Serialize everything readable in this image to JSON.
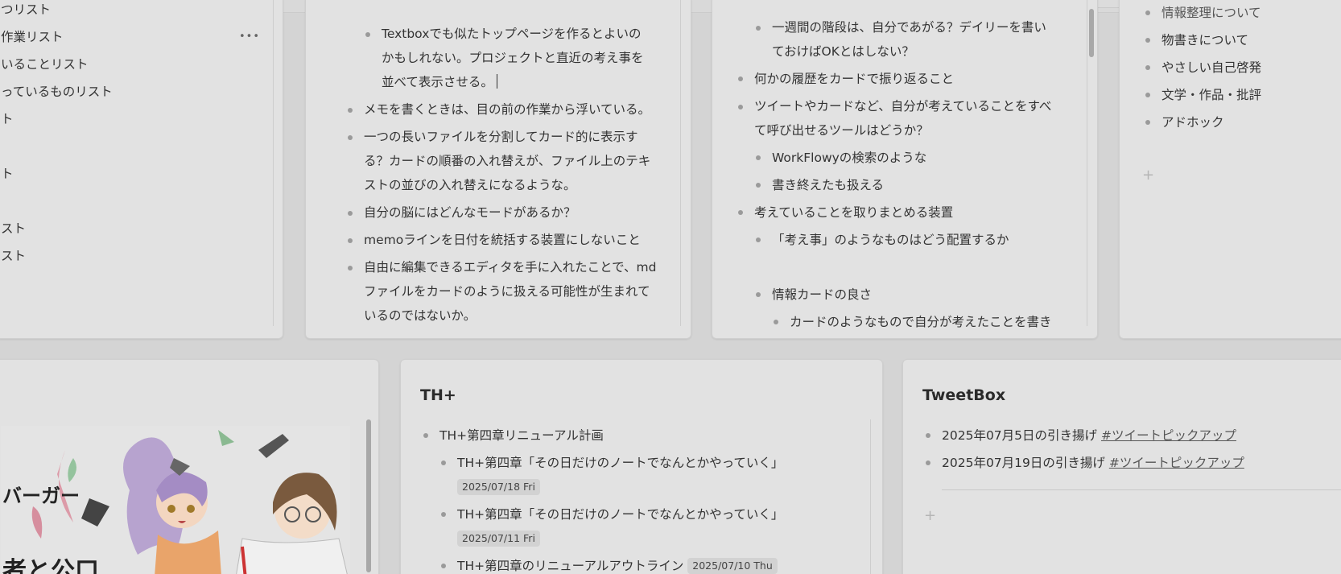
{
  "card1": {
    "items": [
      "つリスト",
      "作業リスト",
      "いることリスト",
      "っているものリスト",
      "ト",
      "",
      "ト",
      "",
      "スト",
      "スト"
    ],
    "more_label": "•••"
  },
  "card2": {
    "items": [
      {
        "text": "Textboxでも似たトップページを作るとよいのかもしれない。プロジェクトと直近の考え事を並べて表示させる。",
        "level": 2
      },
      {
        "text": "メモを書くときは、目の前の作業から浮いている。",
        "level": 1
      },
      {
        "text": "一つの長いファイルを分割してカード的に表示する？カードの順番の入れ替えが、ファイル上のテキストの並びの入れ替えになるような。",
        "level": 1
      },
      {
        "text": "自分の脳にはどんなモードがあるか？",
        "level": 1
      },
      {
        "text": "memoラインを日付を統括する装置にしないこと",
        "level": 1
      },
      {
        "text": "自由に編集できるエディタを手に入れたことで、mdファイルをカードのように扱える可能性が生まれているのではないか。",
        "level": 1
      }
    ]
  },
  "card3": {
    "items": [
      {
        "text": "一週間の階段は、自分であがる？デイリーを書いておけばOKとはしない？",
        "level": 2
      },
      {
        "text": "何かの履歴をカードで振り返ること",
        "level": 1
      },
      {
        "text": "ツイートやカードなど、自分が考えていることをすべて呼び出せるツールはどうか？",
        "level": 1
      },
      {
        "text": "WorkFlowyの検索のような",
        "level": 2
      },
      {
        "text": "書き終えたも扱える",
        "level": 2
      },
      {
        "text": "考えていることを取りまとめる装置",
        "level": 1
      },
      {
        "text": "「考え事」のようなものはどう配置するか",
        "level": 2
      },
      {
        "text": "",
        "level": 2
      },
      {
        "text": "情報カードの良さ",
        "level": 2
      },
      {
        "text": "カードのようなもので自分が考えたことを書き",
        "level": 3
      }
    ]
  },
  "card4": {
    "items": [
      "情報整理について",
      "物書きについて",
      "やさしい自己啓発",
      "文学・作品・批評",
      "アドホック"
    ],
    "plus_label": "+"
  },
  "card5": {
    "image_texts": [
      "バーガー",
      "者と公口"
    ]
  },
  "card6": {
    "title": "TH+",
    "items": [
      {
        "text": "TH+第四章リニューアル計画",
        "level": 1,
        "date": ""
      },
      {
        "text": "TH+第四章「その日だけのノートでなんとかやっていく」",
        "level": 2,
        "date": "2025/07/18 Fri"
      },
      {
        "text": "TH+第四章「その日だけのノートでなんとかやっていく」",
        "level": 2,
        "date": "2025/07/11 Fri"
      },
      {
        "text": "TH+第四章のリニューアルアウトライン",
        "level": 2,
        "date": "2025/07/10 Thu"
      }
    ]
  },
  "card7": {
    "title": "TweetBox",
    "items": [
      {
        "text": "2025年07月5日の引き揚げ ",
        "tag": "#ツイートピックアップ"
      },
      {
        "text": "2025年07月19日の引き揚げ ",
        "tag": "#ツイートピックアップ"
      }
    ],
    "plus_label": "+"
  }
}
